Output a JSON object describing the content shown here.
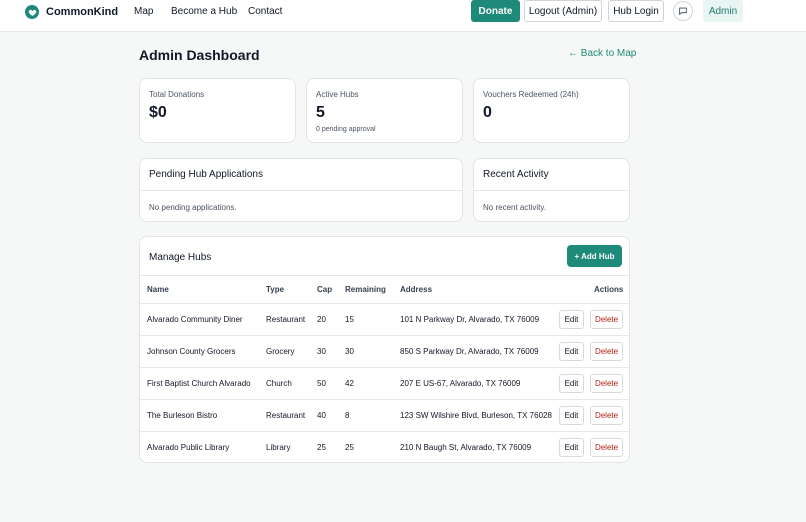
{
  "brand": {
    "name": "CommonKind"
  },
  "nav": {
    "map": "Map",
    "become_hub": "Become a Hub",
    "contact": "Contact"
  },
  "actions": {
    "donate": "Donate",
    "logout": "Logout (Admin)",
    "hub_login": "Hub Login",
    "admin": "Admin"
  },
  "header": {
    "title": "Admin Dashboard",
    "back_link": "← Back to Map"
  },
  "stats": [
    {
      "label": "Total Donations",
      "value": "$0",
      "sub": ""
    },
    {
      "label": "Active Hubs",
      "value": "5",
      "sub": "0 pending approval"
    },
    {
      "label": "Vouchers Redeemed (24h)",
      "value": "0",
      "sub": ""
    }
  ],
  "pending": {
    "title": "Pending Hub Applications",
    "empty": "No pending applications."
  },
  "activity": {
    "title": "Recent Activity",
    "empty": "No recent activity."
  },
  "manage": {
    "title": "Manage Hubs",
    "add_label": "+ Add Hub",
    "columns": [
      "Name",
      "Type",
      "Cap",
      "Remaining",
      "Address",
      "Actions"
    ],
    "edit_label": "Edit",
    "delete_label": "Delete",
    "rows": [
      {
        "name": "Alvarado Community Diner",
        "type": "Restaurant",
        "cap": "20",
        "remaining": "15",
        "address": "101 N Parkway Dr, Alvarado, TX 76009"
      },
      {
        "name": "Johnson County Grocers",
        "type": "Grocery",
        "cap": "30",
        "remaining": "30",
        "address": "850 S Parkway Dr, Alvarado, TX 76009"
      },
      {
        "name": "First Baptist Church Alvarado",
        "type": "Church",
        "cap": "50",
        "remaining": "42",
        "address": "207 E US-67, Alvarado, TX 76009"
      },
      {
        "name": "The Burleson Bistro",
        "type": "Restaurant",
        "cap": "40",
        "remaining": "8",
        "address": "123 SW Wilshire Blvd, Burleson, TX 76028"
      },
      {
        "name": "Alvarado Public Library",
        "type": "Library",
        "cap": "25",
        "remaining": "25",
        "address": "210 N Baugh St, Alvarado, TX 76009"
      }
    ]
  },
  "icons": {
    "brand": "heart-icon",
    "chat": "chat-bubble-icon"
  },
  "colors": {
    "accent": "#1e8a7a",
    "delete": "#b42318",
    "admin_badge_bg": "#e9f5f2"
  }
}
